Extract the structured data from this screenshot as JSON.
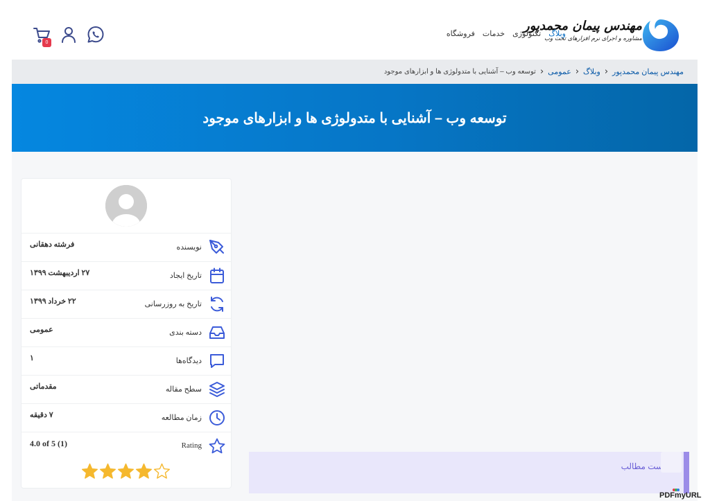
{
  "header": {
    "brand_name": "مهندس پیمان محمدپور",
    "brand_sub": "مشاوره و اجرای نرم افزارهای تحت وب",
    "nav": [
      {
        "label": "وبلاگ",
        "active": true
      },
      {
        "label": "تکنولوژی",
        "active": false
      },
      {
        "label": "خدمات",
        "active": false
      },
      {
        "label": "فروشگاه",
        "active": false
      }
    ],
    "icons": [
      "whatsapp-icon",
      "user-icon",
      "cart-icon"
    ],
    "cart_count": "0"
  },
  "breadcrumb": {
    "items": [
      "مهندس پیمان محمدپور",
      "وبلاگ",
      "عمومی"
    ],
    "current": "توسعه وب – آشنایی با متدولوژی ها و ابزارهای موجود"
  },
  "banner": {
    "title": "توسعه وب – آشنایی با متدولوژی ها و ابزارهای موجود"
  },
  "info": {
    "rows": [
      {
        "label": "نویسنده",
        "value": "فرشته دهقانی",
        "icon": "pen-nib-icon"
      },
      {
        "label": "تاریخ ایجاد",
        "value": "۲۷ اردیبهشت ۱۳۹۹",
        "icon": "calendar-icon"
      },
      {
        "label": "تاریخ به روزرسانی",
        "value": "۲۲ خرداد ۱۳۹۹",
        "icon": "refresh-icon"
      },
      {
        "label": "دسته بندی",
        "value": "عمومی",
        "icon": "inbox-icon"
      },
      {
        "label": "دیدگاه‌ها",
        "value": "۱",
        "icon": "comment-icon"
      },
      {
        "label": "سطح مقاله",
        "value": "مقدماتی",
        "icon": "layers-icon"
      },
      {
        "label": "زمان مطالعه",
        "value": "۷ دقیقه",
        "icon": "clock-icon"
      },
      {
        "label": "Rating",
        "value": "4.0 of 5 (1)",
        "icon": "star-outline-icon"
      }
    ],
    "rating": {
      "value": 4,
      "max": 5
    }
  },
  "toc": {
    "title": "فهرست مطالب"
  },
  "watermark": "PDFmyURL",
  "colors": {
    "accent": "#0a6dc2",
    "banner": "#0676c6",
    "star": "#f5b82e",
    "toc_bg": "#e9e7fb",
    "toc_border": "#9b8ce8",
    "icon_blue": "#3b5bd9"
  }
}
